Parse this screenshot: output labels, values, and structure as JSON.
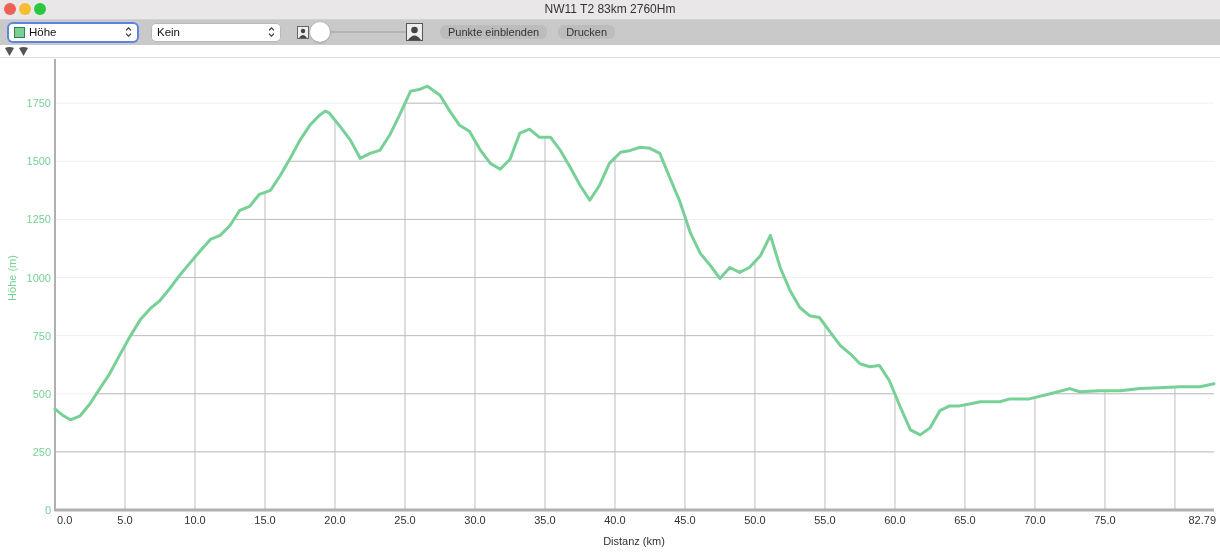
{
  "window": {
    "title": "NW11 T2 83km 2760Hm"
  },
  "toolbar": {
    "compare_select": {
      "value": "Kein"
    },
    "zoom_slider": {
      "level": 0
    },
    "buttons": [
      "Punkte einblenden",
      "Drucken"
    ]
  },
  "chart": {
    "chart_data": {
      "type": "line",
      "grid": true,
      "xlabel": "Distanz (km)",
      "ylabel": "Höhe (m)",
      "xlim": [
        0,
        82.79
      ],
      "ylim": [
        0,
        1940
      ],
      "xticks": [
        {
          "value": 0,
          "label": "0.0"
        },
        {
          "value": 5,
          "label": "5.0"
        },
        {
          "value": 10,
          "label": "10.0"
        },
        {
          "value": 15,
          "label": "15.0"
        },
        {
          "value": 20,
          "label": "20.0"
        },
        {
          "value": 25,
          "label": "25.0"
        },
        {
          "value": 30,
          "label": "30.0"
        },
        {
          "value": 35,
          "label": "35.0"
        },
        {
          "value": 40,
          "label": "40.0"
        },
        {
          "value": 45,
          "label": "45.0"
        },
        {
          "value": 50,
          "label": "50.0"
        },
        {
          "value": 55,
          "label": "55.0"
        },
        {
          "value": 60,
          "label": "60.0"
        },
        {
          "value": 65,
          "label": "65.0"
        },
        {
          "value": 70,
          "label": "70.0"
        },
        {
          "value": 75,
          "label": "75.0"
        },
        {
          "value": 82.79,
          "label": "82.79"
        }
      ],
      "yticks": [
        0,
        250,
        500,
        750,
        1000,
        1250,
        1500,
        1750
      ],
      "x": [
        0,
        0.6,
        1.1,
        1.8,
        2.5,
        3.2,
        3.9,
        4.6,
        5.4,
        6.1,
        6.8,
        7.5,
        8.2,
        8.9,
        9.6,
        10.4,
        11.1,
        11.8,
        12.5,
        13.2,
        13.9,
        14.6,
        15.4,
        16.1,
        16.8,
        17.5,
        18.2,
        18.9,
        19.3,
        19.6,
        20.4,
        21.1,
        21.8,
        22.5,
        23.2,
        23.9,
        24.6,
        25.4,
        26.1,
        26.6,
        27.5,
        28.2,
        28.9,
        29.6,
        30.4,
        31.1,
        31.8,
        32.5,
        33.2,
        33.9,
        34.6,
        35.4,
        36.1,
        36.8,
        37.5,
        38.2,
        38.9,
        39.6,
        40.4,
        41.1,
        41.8,
        42.5,
        43.2,
        43.9,
        44.6,
        45.4,
        46.1,
        46.8,
        47.5,
        48.2,
        48.9,
        49.6,
        50.4,
        51.1,
        51.8,
        52.5,
        53.2,
        53.9,
        54.6,
        55.4,
        56.1,
        56.8,
        57.5,
        58.2,
        58.9,
        59.6,
        60.4,
        61.1,
        61.8,
        62.5,
        63.2,
        63.9,
        64.6,
        65.4,
        66.1,
        67.5,
        68.2,
        69.6,
        71.1,
        72.5,
        73.2,
        74.6,
        76.1,
        77.5,
        78.9,
        80.4,
        81.8,
        82.79
      ],
      "series": [
        {
          "name": "Höhe",
          "color": "#77d196",
          "values": [
            435,
            405,
            388,
            405,
            457,
            522,
            586,
            664,
            750,
            819,
            866,
            901,
            953,
            1009,
            1060,
            1116,
            1164,
            1181,
            1224,
            1289,
            1306,
            1358,
            1375,
            1440,
            1513,
            1591,
            1655,
            1698,
            1716,
            1707,
            1647,
            1591,
            1513,
            1534,
            1547,
            1612,
            1698,
            1802,
            1810,
            1823,
            1784,
            1716,
            1655,
            1629,
            1547,
            1491,
            1466,
            1509,
            1621,
            1638,
            1603,
            1603,
            1547,
            1474,
            1397,
            1332,
            1397,
            1491,
            1539,
            1547,
            1560,
            1556,
            1534,
            1431,
            1332,
            1190,
            1103,
            1052,
            996,
            1043,
            1022,
            1043,
            1095,
            1181,
            1043,
            944,
            871,
            836,
            828,
            763,
            707,
            672,
            629,
            616,
            621,
            556,
            440,
            345,
            323,
            353,
            427,
            448,
            448,
            457,
            466,
            466,
            478,
            478,
            500,
            522,
            509,
            513,
            513,
            522,
            526,
            530,
            530,
            543
          ]
        }
      ]
    }
  }
}
